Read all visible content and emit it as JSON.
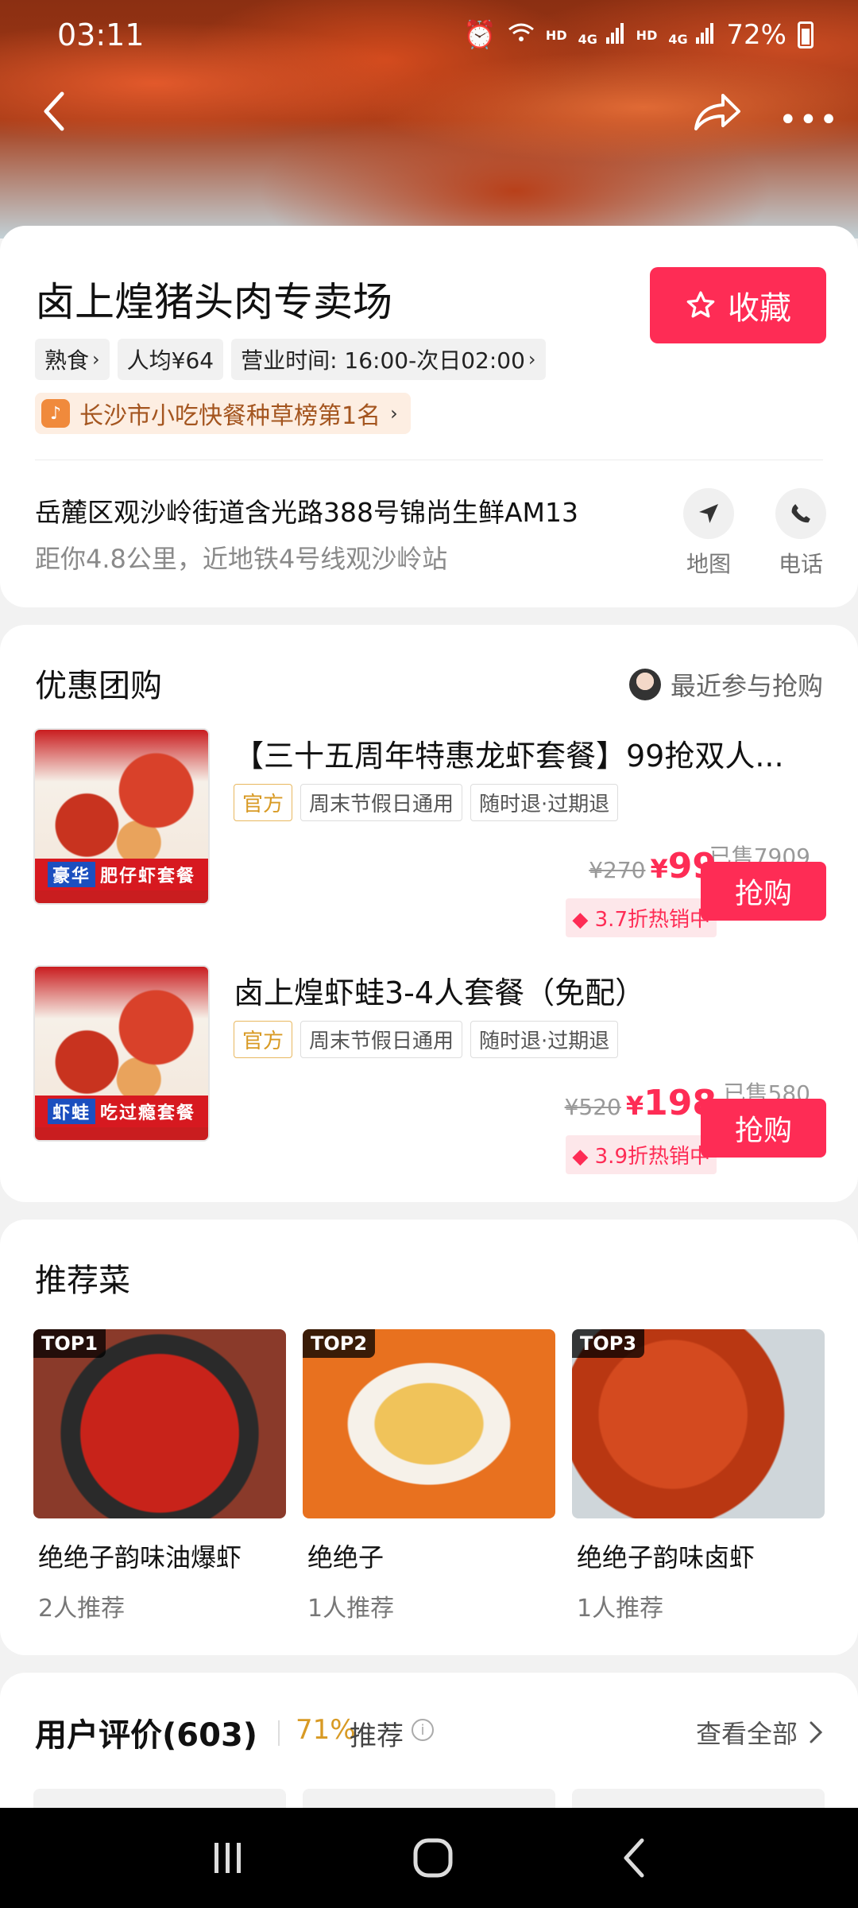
{
  "status": {
    "time": "03:11",
    "hd1": "HD",
    "net1": "4G",
    "hd2": "HD",
    "net2": "4G",
    "battery": "72%"
  },
  "nav": {
    "more": "•••"
  },
  "shop": {
    "title": "卤上煌猪头肉专卖场",
    "favorite_label": "收藏",
    "tags": [
      "熟食",
      "人均¥64",
      "营业时间: 16:00-次日02:00"
    ],
    "rank": "长沙市小吃快餐种草榜第1名",
    "address": "岳麓区观沙岭街道含光路388号锦尚生鲜AM13",
    "distance": "距你4.8公里，近地铁4号线观沙岭站",
    "map_label": "地图",
    "phone_label": "电话"
  },
  "deals": {
    "section_title": "优惠团购",
    "recent_label": "最近参与抢购",
    "items": [
      {
        "title": "【三十五周年特惠龙虾套餐】99抢双人...",
        "tags": [
          "官方",
          "周末节假日通用",
          "随时退·过期退"
        ],
        "sold": "已售7909",
        "original_price": "¥270",
        "currency": "¥",
        "price": "99",
        "discount": "3.7折热销中",
        "buy_label": "抢购",
        "image_banner_a": "豪华",
        "image_banner_b": "肥仔虾套餐"
      },
      {
        "title": "卤上煌虾蛙3-4人套餐（免配）",
        "tags": [
          "官方",
          "周末节假日通用",
          "随时退·过期退"
        ],
        "sold": "已售580",
        "original_price": "¥520",
        "currency": "¥",
        "price": "198",
        "discount": "3.9折热销中",
        "buy_label": "抢购",
        "image_banner_a": "虾蛙",
        "image_banner_b": "吃过瘾套餐"
      }
    ]
  },
  "dishes": {
    "section_title": "推荐菜",
    "items": [
      {
        "badge": "TOP1",
        "name": "绝绝子韵味油爆虾",
        "rec": "2人推荐"
      },
      {
        "badge": "TOP2",
        "name": "绝绝子",
        "rec": "1人推荐"
      },
      {
        "badge": "TOP3",
        "name": "绝绝子韵味卤虾",
        "rec": "1人推荐"
      }
    ]
  },
  "reviews": {
    "title": "用户评价(603)",
    "percent": "71%",
    "percent_label": "推荐",
    "info": "i",
    "view_all": "查看全部"
  },
  "colors": {
    "accent": "#fe2c55",
    "official": "#d89a24",
    "rank_text": "#a4551f"
  }
}
